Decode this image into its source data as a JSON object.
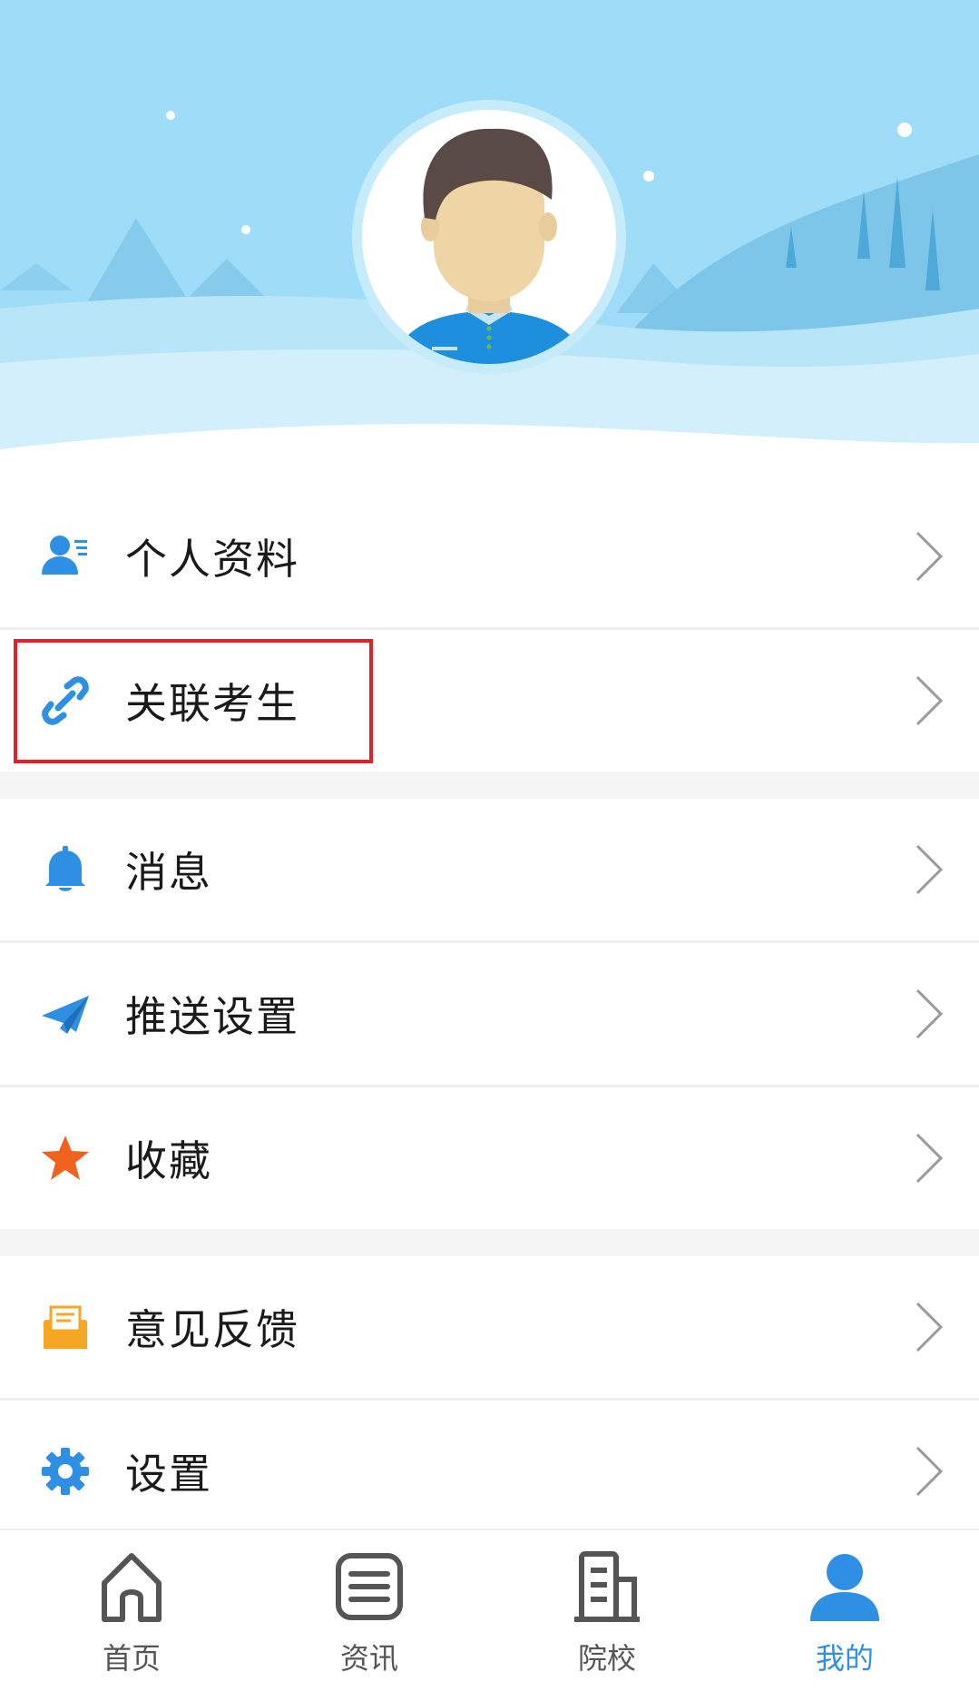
{
  "menu": {
    "items": [
      {
        "label": "个人资料",
        "icon": "profile-card-icon"
      },
      {
        "label": "关联考生",
        "icon": "link-icon"
      },
      {
        "label": "消息",
        "icon": "bell-icon"
      },
      {
        "label": "推送设置",
        "icon": "paper-plane-icon"
      },
      {
        "label": "收藏",
        "icon": "star-icon"
      },
      {
        "label": "意见反馈",
        "icon": "envelope-icon"
      },
      {
        "label": "设置",
        "icon": "gear-icon"
      }
    ]
  },
  "tabbar": {
    "tabs": [
      {
        "label": "首页",
        "icon": "home-icon",
        "active": false
      },
      {
        "label": "资讯",
        "icon": "news-icon",
        "active": false
      },
      {
        "label": "院校",
        "icon": "building-icon",
        "active": false
      },
      {
        "label": "我的",
        "icon": "user-icon",
        "active": true
      }
    ]
  },
  "colors": {
    "sky": "#9fdcf7",
    "accent_blue": "#2f8fe3",
    "star_orange": "#f0631f",
    "envelope_orange": "#f5a623",
    "highlight_red": "#e0202a",
    "inactive_tab": "#555555"
  }
}
